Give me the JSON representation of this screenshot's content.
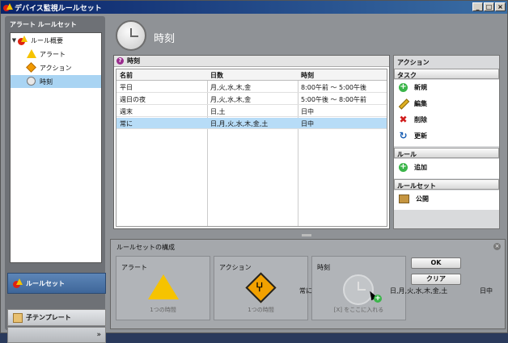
{
  "window": {
    "title": "デバイス監視ルールセット",
    "buttons": [
      "_",
      "□",
      "×"
    ]
  },
  "left_panel": {
    "title": "アラート ルールセット",
    "tree": [
      {
        "label": "ルール概要",
        "icon": "rules-icon",
        "expanded": true
      },
      {
        "label": "アラート",
        "icon": "alert-triangle-icon"
      },
      {
        "label": "アクション",
        "icon": "action-diamond-icon"
      },
      {
        "label": "時刻",
        "icon": "clock-icon",
        "selected": true
      }
    ],
    "nav": {
      "active": "ルールセット",
      "templates": "子テンプレート",
      "more": "»"
    }
  },
  "header": {
    "title": "時刻",
    "icon": "clock-icon"
  },
  "table_panel": {
    "title": "時刻",
    "columns": [
      "名前",
      "日数",
      "時刻"
    ],
    "rows": [
      [
        "平日",
        "月,火,水,木,金",
        "8:00午前 ～ 5:00午後"
      ],
      [
        "週日の夜",
        "月,火,水,木,金",
        "5:00午後 ～ 8:00午前"
      ],
      [
        "週末",
        "日,土",
        "日中"
      ],
      [
        "常に",
        "日,月,火,水,木,金,土",
        "日中"
      ]
    ],
    "selected_row": 3
  },
  "action_panel": {
    "title": "アクション",
    "sections": [
      {
        "title": "タスク",
        "items": [
          {
            "label": "新規",
            "icon": "plus-icon"
          },
          {
            "label": "編集",
            "icon": "pencil-icon"
          },
          {
            "label": "削除",
            "icon": "delete-x-icon"
          },
          {
            "label": "更新",
            "icon": "refresh-icon"
          }
        ]
      },
      {
        "title": "ルール",
        "items": [
          {
            "label": "追加",
            "icon": "plus-icon"
          }
        ]
      },
      {
        "title": "ルールセット",
        "items": [
          {
            "label": "公開",
            "icon": "publish-icon"
          }
        ]
      }
    ]
  },
  "bottom_panel": {
    "title": "ルールセットの構成",
    "slots": [
      {
        "label": "アラート",
        "caption": "1つの時間"
      },
      {
        "label": "アクション",
        "caption": "1つの時間"
      },
      {
        "label": "時刻",
        "caption": "[X] をここに入れる"
      }
    ],
    "summary": {
      "always": "常に",
      "days": "日,月,火,水,木,金,土",
      "time": "日中"
    },
    "ok_label": "OK",
    "clear_label": "クリア"
  }
}
